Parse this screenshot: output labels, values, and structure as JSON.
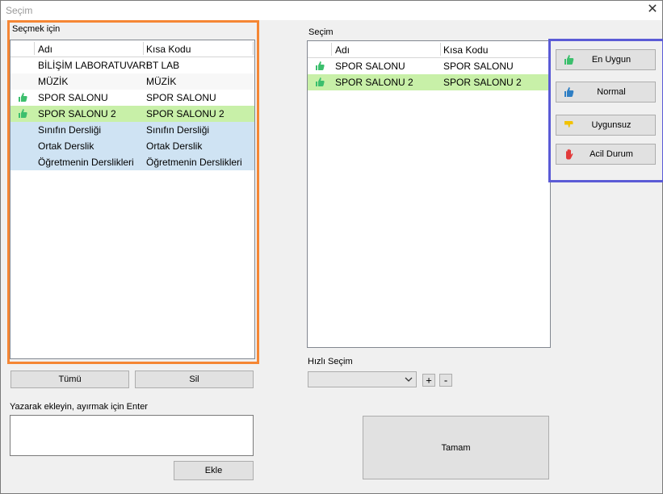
{
  "window": {
    "title": "Seçim",
    "close": "✕"
  },
  "left_panel": {
    "title": "Seçmek için",
    "col_name": "Adı",
    "col_code": "Kısa Kodu",
    "rows": [
      {
        "name": "BİLİŞİM LABORATUVARI",
        "code": "BT LAB",
        "bg": "#ffffff",
        "thumb": ""
      },
      {
        "name": "MÜZİK",
        "code": "MÜZİK",
        "bg": "#f7f7f7",
        "thumb": ""
      },
      {
        "name": "SPOR SALONU",
        "code": "SPOR SALONU",
        "bg": "#ffffff",
        "thumb": "#3cbf6d"
      },
      {
        "name": "SPOR SALONU 2",
        "code": "SPOR SALONU 2",
        "bg": "#c8f0a8",
        "thumb": "#3cbf6d"
      },
      {
        "name": "Sınıfın Dersliği",
        "code": "Sınıfın Dersliği",
        "bg": "#cfe3f3",
        "thumb": ""
      },
      {
        "name": "Ortak Derslik",
        "code": "Ortak Derslik",
        "bg": "#cfe3f3",
        "thumb": ""
      },
      {
        "name": "Öğretmenin Derslikleri",
        "code": "Öğretmenin Derslikleri",
        "bg": "#cfe3f3",
        "thumb": ""
      }
    ],
    "btn_all": "Tümü",
    "btn_delete": "Sil"
  },
  "type_add": {
    "label": "Yazarak ekleyin, ayırmak için Enter",
    "value": "",
    "btn_add": "Ekle"
  },
  "right_panel": {
    "title": "Seçim",
    "col_name": "Adı",
    "col_code": "Kısa Kodu",
    "rows": [
      {
        "name": "SPOR SALONU",
        "code": "SPOR SALONU",
        "bg": "#ffffff",
        "thumb": "#3cbf6d"
      },
      {
        "name": "SPOR SALONU 2",
        "code": "SPOR SALONU 2",
        "bg": "#c8f0a8",
        "thumb": "#3cbf6d"
      }
    ]
  },
  "quick": {
    "label": "Hızlı Seçim",
    "selected": "",
    "plus": "+",
    "minus": "-"
  },
  "ok_button": "Tamam",
  "ratings": [
    {
      "label": "En Uygun",
      "icon": "thumb-up-green-icon",
      "color": "#3cbf6d"
    },
    {
      "label": "Normal",
      "icon": "thumb-up-blue-icon",
      "color": "#2f7fc4"
    },
    {
      "label": "Uygunsuz",
      "icon": "thumb-down-yellow-icon",
      "color": "#f2c200"
    },
    {
      "label": "Acil Durum",
      "icon": "stop-hand-red-icon",
      "color": "#e23a3a"
    }
  ]
}
